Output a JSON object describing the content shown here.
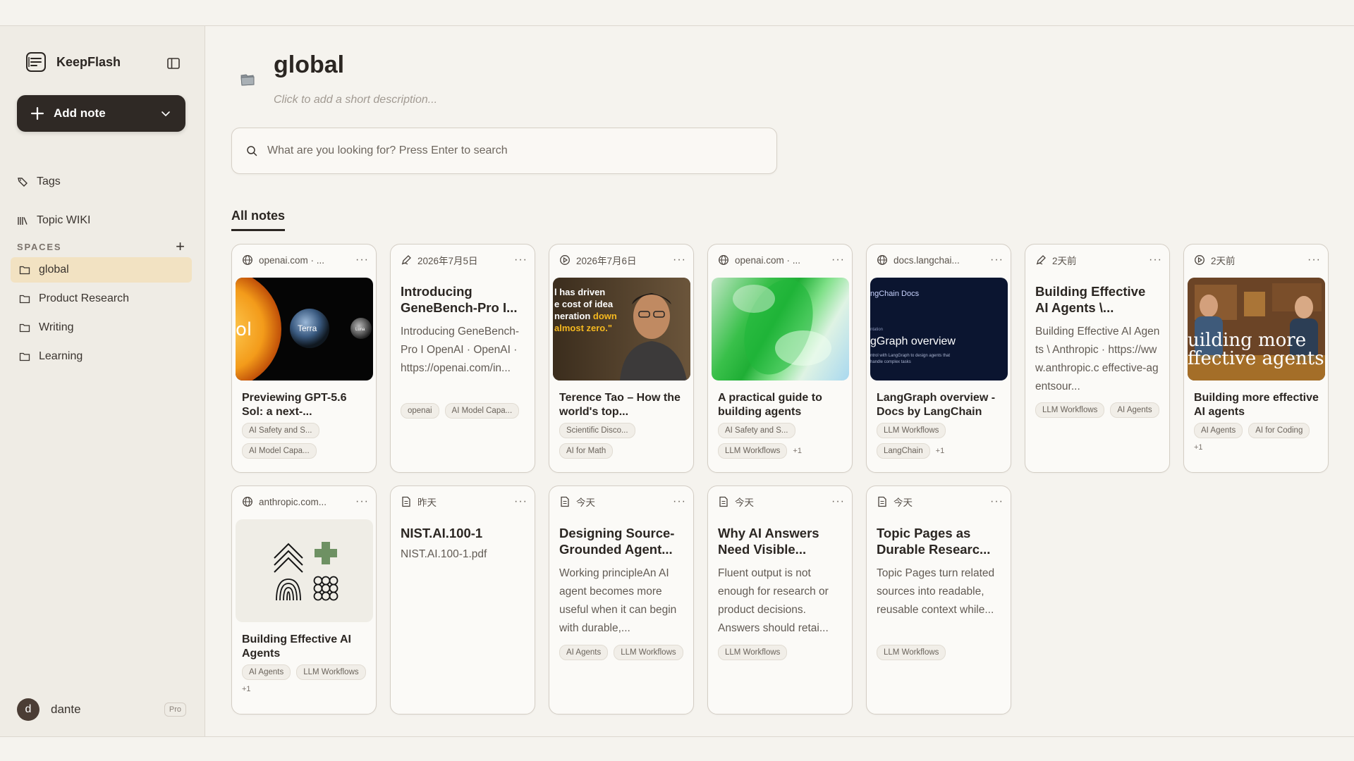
{
  "app": {
    "name": "KeepFlash"
  },
  "sidebar": {
    "add_note_label": "Add note",
    "nav": [
      {
        "label": "Tags"
      },
      {
        "label": "Topic WIKI"
      }
    ],
    "spaces_label": "SPACES",
    "spaces": [
      {
        "label": "global",
        "active": true
      },
      {
        "label": "Product Research"
      },
      {
        "label": "Writing"
      },
      {
        "label": "Learning"
      }
    ],
    "user": {
      "initial": "d",
      "name": "dante",
      "plan": "Pro"
    }
  },
  "main": {
    "title": "global",
    "description_placeholder": "Click to add a short description...",
    "search_placeholder": "What are you looking for? Press Enter to search",
    "section_tab": "All notes",
    "notes": [
      {
        "source": "openai.com · ...",
        "source_icon": "globe-icon",
        "thumb": "sun-planets",
        "thumb_text": [
          "ol",
          "Terra",
          "Luna"
        ],
        "title": "Previewing GPT-5.6 Sol: a next-...",
        "tags": [
          "AI Safety and S...",
          "AI Model Capa..."
        ],
        "extra": ""
      },
      {
        "source": "2026年7月5日",
        "source_icon": "pen-icon",
        "title": "Introducing GeneBench-Pro I...",
        "body": "Introducing GeneBench-Pro I OpenAI · OpenAI · https://openai.com/in...",
        "tags": [
          "openai",
          "AI Model Capa..."
        ],
        "extra": ""
      },
      {
        "source": "2026年7月6日",
        "source_icon": "play-icon",
        "thumb": "portrait-quote",
        "thumb_text": [
          "l has driven",
          "e cost of idea",
          "neration ",
          "down",
          "almost zero.\""
        ],
        "title": "Terence Tao – How the world's top...",
        "tags": [
          "Scientific Disco...",
          "AI for Math"
        ],
        "extra": ""
      },
      {
        "source": "openai.com · ...",
        "source_icon": "globe-icon",
        "thumb": "green-gradient",
        "title": "A practical guide to building agents",
        "tags": [
          "AI Safety and S...",
          "LLM Workflows"
        ],
        "extra": "+1"
      },
      {
        "source": "docs.langchai...",
        "source_icon": "globe-icon",
        "thumb": "langgraph-doc",
        "thumb_text": [
          "ngChain Docs",
          "ntation",
          "gGraph overview",
          "ntrol with LangGraph to design agents that",
          "handle complex tasks"
        ],
        "title": "LangGraph overview - Docs by LangChain",
        "tags": [
          "LLM Workflows",
          "LangChain"
        ],
        "extra": "+1"
      },
      {
        "source": "2天前",
        "source_icon": "pen-icon",
        "title": "Building Effective AI Agents \\...",
        "body": "Building Effective AI Agents \\ Anthropic · https://www.anthropic.c effective-agentsour...",
        "tags": [
          "LLM Workflows",
          "AI Agents"
        ],
        "extra": ""
      },
      {
        "source": "2天前",
        "source_icon": "play-icon",
        "thumb": "podcast-room",
        "thumb_text": [
          "uilding more",
          "ffective agents"
        ],
        "title": "Building more effective AI agents",
        "tags": [
          "AI Agents",
          "AI for Coding"
        ],
        "extra": "+1"
      },
      {
        "source": "anthropic.com...",
        "source_icon": "globe-icon",
        "thumb": "anthropic-art",
        "title": "Building Effective AI Agents",
        "tags": [
          "AI Agents",
          "LLM Workflows"
        ],
        "extra": "+1"
      },
      {
        "source": "昨天",
        "source_icon": "doc-icon",
        "title": "NIST.AI.100-1",
        "body": "NIST.AI.100-1.pdf",
        "tags": [],
        "extra": ""
      },
      {
        "source": "今天",
        "source_icon": "doc-icon",
        "title": "Designing Source-Grounded Agent...",
        "body": "Working principleAn AI agent becomes more useful when it can begin with durable,...",
        "tags": [
          "AI Agents",
          "LLM Workflows"
        ],
        "extra": ""
      },
      {
        "source": "今天",
        "source_icon": "doc-icon",
        "title": "Why AI Answers Need Visible...",
        "body": "Fluent output is not enough for research or product decisions. Answers should retai...",
        "tags": [
          "LLM Workflows"
        ],
        "extra": ""
      },
      {
        "source": "今天",
        "source_icon": "doc-icon",
        "title": "Topic Pages as Durable Researc...",
        "body": "Topic Pages turn related sources into readable, reusable context while...",
        "tags": [
          "LLM Workflows"
        ],
        "extra": ""
      }
    ]
  },
  "colors": {
    "accent_dark": "#2f2925",
    "active_space": "#f2e2c2",
    "background": "#f5f3ee"
  }
}
